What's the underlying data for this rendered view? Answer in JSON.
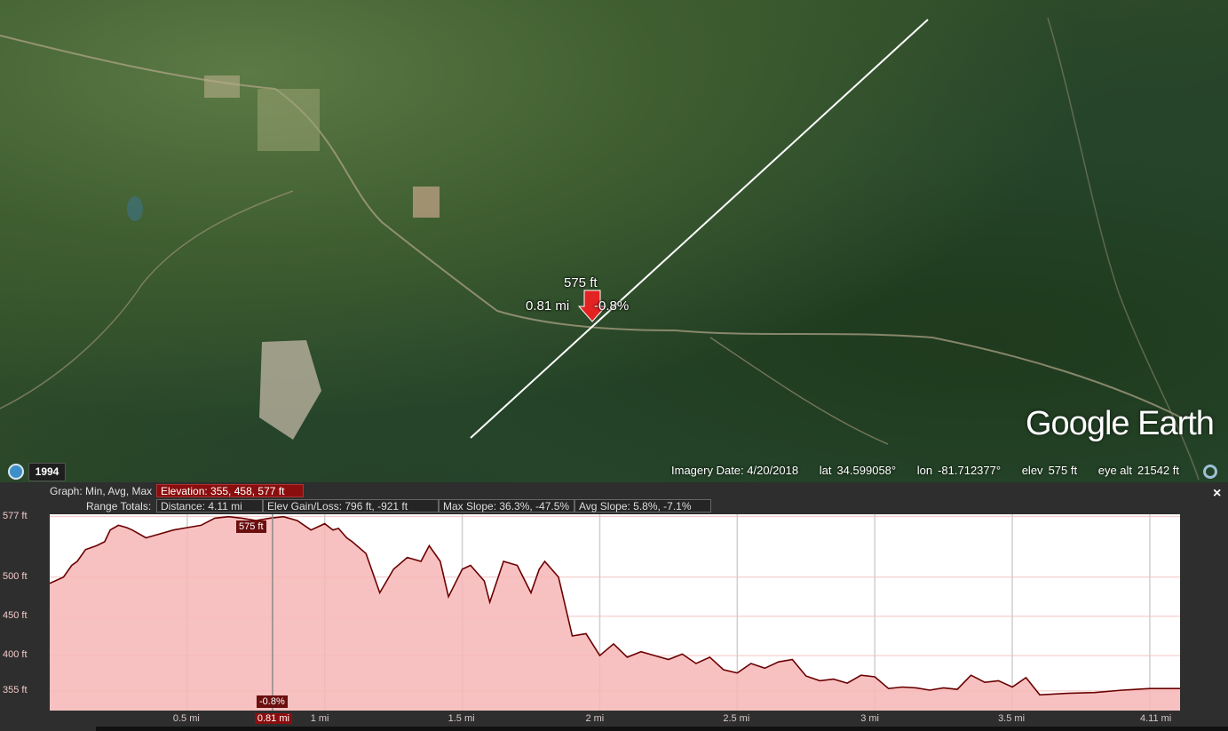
{
  "map": {
    "marker": {
      "elevation_label": "575 ft",
      "distance_label": "0.81 mi",
      "slope_label": "-0.8%"
    },
    "logo": "Google Earth",
    "historical_imagery": {
      "year": "1994"
    },
    "status": {
      "imagery_date": "Imagery Date: 4/20/2018",
      "lat_label": "lat",
      "lat_value": "34.599058°",
      "lon_label": "lon",
      "lon_value": "-81.712377°",
      "elev_label": "elev",
      "elev_value": "575 ft",
      "eye_label": "eye alt",
      "eye_value": "21542 ft"
    }
  },
  "profile": {
    "graph_label": "Graph: Min, Avg, Max",
    "elevation_stat": "Elevation: 355, 458, 577 ft",
    "range_label": "Range Totals:",
    "distance_stat": "Distance: 4.11 mi",
    "gain_loss_stat": "Elev Gain/Loss: 796 ft, -921 ft",
    "max_slope_stat": "Max Slope: 36.3%, -47.5%",
    "avg_slope_stat": "Avg Slope: 5.8%, -7.1%",
    "close_label": "×",
    "cursor_elev_tag": "575 ft",
    "cursor_slope_tag": "-0.8%",
    "cursor_dist_tag": "0.81 mi",
    "y_ticks": [
      "577 ft",
      "500 ft",
      "450 ft",
      "400 ft",
      "355 ft"
    ],
    "x_ticks": [
      "0.5 mi",
      "1 mi",
      "1.5 mi",
      "2 mi",
      "2.5 mi",
      "3 mi",
      "3.5 mi",
      "4.11 mi"
    ]
  },
  "chart_data": {
    "type": "area",
    "title": "",
    "xlabel": "",
    "ylabel": "",
    "xlim": [
      0,
      4.11
    ],
    "ylim": [
      330,
      580
    ],
    "y_grid_values": [
      577,
      500,
      450,
      400,
      355
    ],
    "x_grid_values": [
      0.5,
      1,
      1.5,
      2,
      2.5,
      3,
      3.5,
      4
    ],
    "cursor_x": 0.81,
    "line_color": "#6b0000",
    "fill_color": "#f7b6b6",
    "series": [
      {
        "x": [
          0,
          0.05,
          0.08,
          0.1,
          0.13,
          0.17,
          0.2,
          0.22,
          0.25,
          0.28,
          0.3,
          0.35,
          0.4,
          0.45,
          0.5,
          0.55,
          0.6,
          0.65,
          0.7,
          0.75,
          0.8,
          0.85,
          0.9,
          0.95,
          1.0,
          1.03,
          1.05,
          1.08,
          1.1,
          1.15,
          1.2,
          1.25,
          1.3,
          1.35,
          1.38,
          1.42,
          1.45,
          1.5,
          1.53,
          1.58,
          1.6,
          1.65,
          1.7,
          1.75,
          1.78,
          1.8,
          1.85,
          1.9,
          1.95,
          2.0,
          2.05,
          2.1,
          2.15,
          2.2,
          2.25,
          2.3,
          2.35,
          2.4,
          2.45,
          2.5,
          2.55,
          2.6,
          2.65,
          2.7,
          2.75,
          2.8,
          2.85,
          2.9,
          2.95,
          3.0,
          3.05,
          3.1,
          3.15,
          3.2,
          3.25,
          3.3,
          3.35,
          3.4,
          3.45,
          3.5,
          3.55,
          3.6,
          3.65,
          3.7,
          3.8,
          3.9,
          4.0,
          4.11
        ],
        "y": [
          492,
          500,
          515,
          520,
          535,
          540,
          545,
          560,
          566,
          563,
          560,
          550,
          555,
          560,
          563,
          566,
          575,
          577,
          575,
          572,
          575,
          577,
          572,
          560,
          568,
          560,
          562,
          550,
          545,
          530,
          480,
          510,
          525,
          520,
          540,
          520,
          475,
          510,
          515,
          495,
          468,
          520,
          515,
          480,
          510,
          520,
          500,
          425,
          428,
          400,
          415,
          398,
          405,
          400,
          395,
          402,
          390,
          398,
          382,
          378,
          390,
          384,
          392,
          395,
          374,
          368,
          370,
          365,
          375,
          373,
          358,
          360,
          359,
          356,
          359,
          357,
          375,
          366,
          368,
          360,
          372,
          350,
          351,
          352,
          353,
          356,
          358,
          358
        ]
      }
    ]
  }
}
